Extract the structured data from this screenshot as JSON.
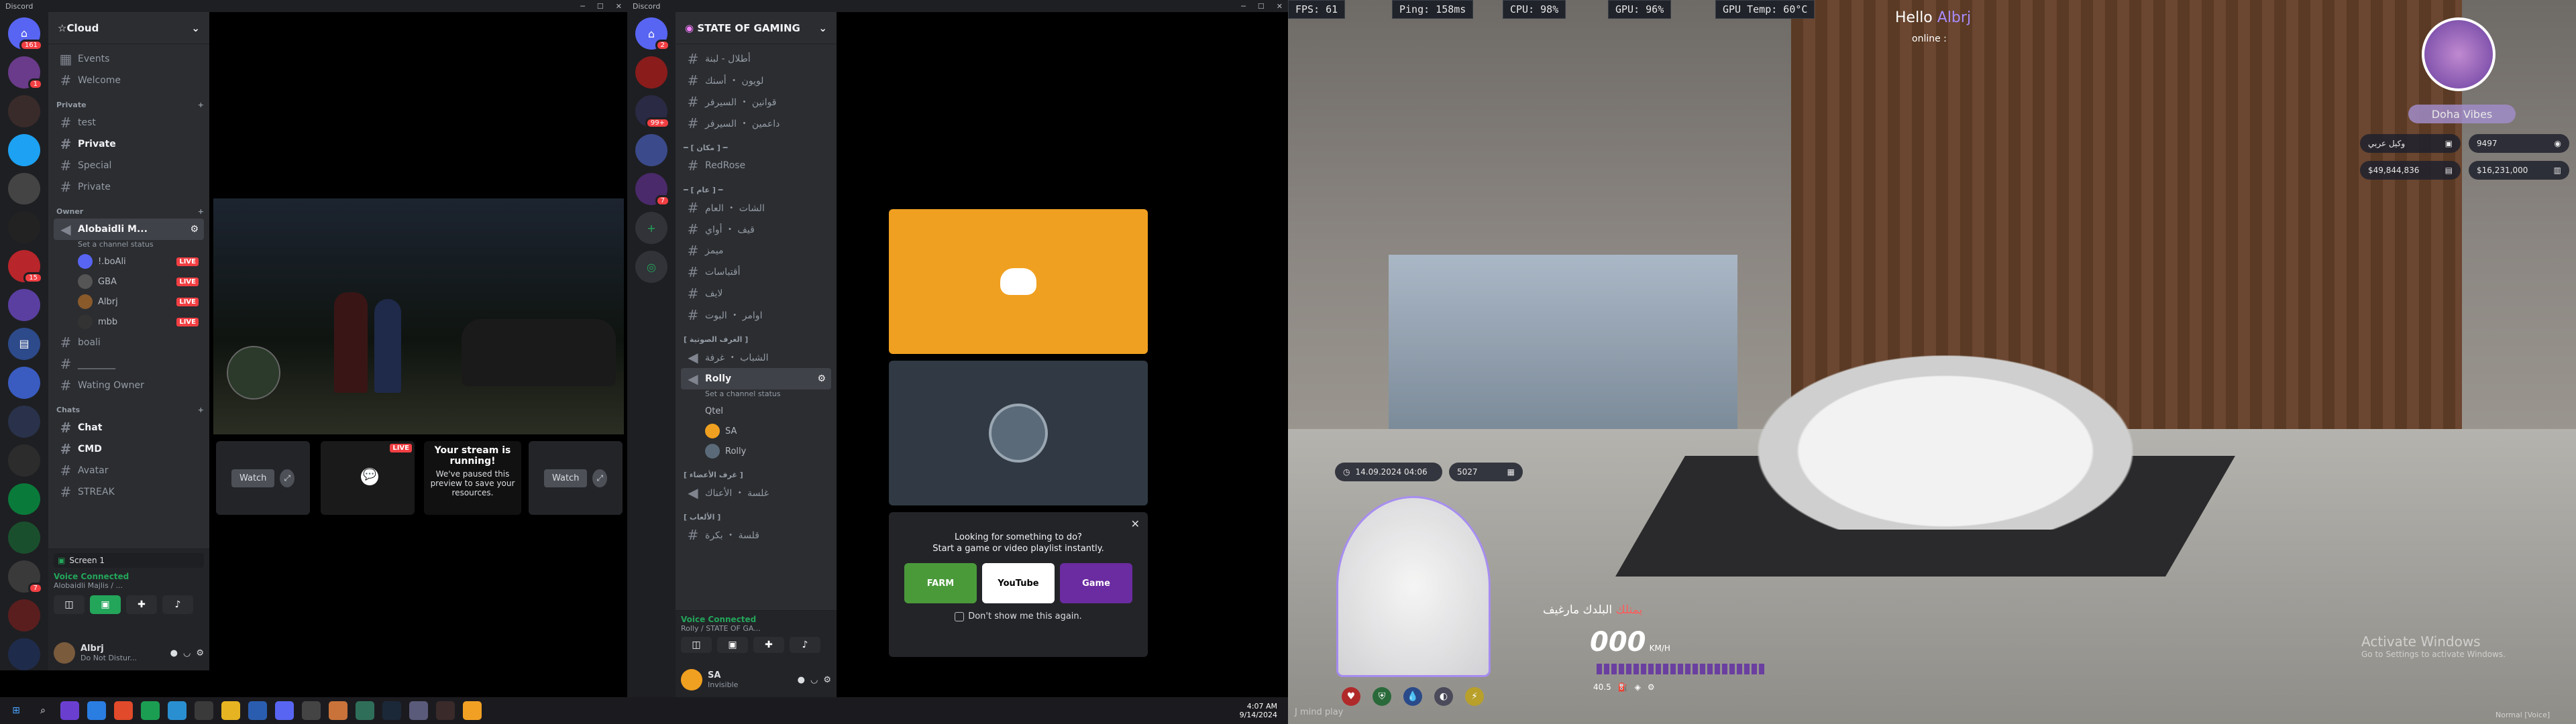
{
  "left_window": {
    "title": "Discord",
    "server_name": "☆Cloud",
    "events_label": "Events",
    "guild_badges": [
      "161",
      "1",
      "",
      "",
      "",
      "",
      "",
      "15",
      "",
      "",
      "",
      "",
      "",
      "",
      "",
      "",
      "7",
      "",
      "",
      ""
    ],
    "channels": [
      {
        "type": "text",
        "name": "Welcome"
      },
      {
        "type": "category",
        "name": "Private"
      },
      {
        "type": "text",
        "name": "test"
      },
      {
        "type": "text",
        "name": "Private",
        "bold": true
      },
      {
        "type": "text",
        "name": "Special"
      },
      {
        "type": "text",
        "name": "Private"
      },
      {
        "type": "category",
        "name": "Owner"
      }
    ],
    "voice_channel": {
      "name": "Alobaidli M...",
      "status": "Set a channel status"
    },
    "voice_users": [
      {
        "name": "!.boAli",
        "live": "LIVE"
      },
      {
        "name": "GBA",
        "live": "LIVE"
      },
      {
        "name": "Albrj",
        "live": "LIVE"
      },
      {
        "name": "mbb",
        "live": "LIVE"
      }
    ],
    "channels2": [
      {
        "type": "text",
        "name": "boali"
      },
      {
        "type": "text",
        "name": "________"
      },
      {
        "type": "text",
        "name": "Wating Owner"
      },
      {
        "type": "category",
        "name": "Chats"
      },
      {
        "type": "text",
        "name": "Chat",
        "bold": true
      },
      {
        "type": "text",
        "name": "CMD",
        "bold": true
      },
      {
        "type": "text",
        "name": "Avatar"
      },
      {
        "type": "text",
        "name": "STREAK"
      }
    ],
    "screen_label": "Screen 1",
    "voice_connected": "Voice Connected",
    "voice_sub": "Alobaidli Majlis / ...",
    "user": {
      "name": "Albrj",
      "status": "Do Not Distur..."
    },
    "stream_cards": {
      "watch": "Watch",
      "live": "LIVE",
      "paused_title": "Your stream is running!",
      "paused_body": "We've paused this preview to save your resources."
    }
  },
  "right_window": {
    "title": "Discord",
    "server_name": "STATE OF GAMING",
    "guild_badges": [
      "2",
      "",
      "99+",
      "",
      "7",
      "",
      ""
    ],
    "channels": [
      {
        "name": "أطلال - لبنة",
        "icon": "#"
      },
      {
        "name": "لويون ・ أسنك",
        "icon": "#"
      },
      {
        "name": "قوانين ・ السيرفر",
        "icon": "#"
      },
      {
        "name": "داعمين ・ السيرفر",
        "icon": "#"
      },
      {
        "name": "━ [ مكان ] ━",
        "icon": "cat"
      },
      {
        "name": "RedRose",
        "icon": "#"
      },
      {
        "name": "━ [ عام ] ━",
        "icon": "cat"
      },
      {
        "name": "الشات ・ العام",
        "icon": "#"
      },
      {
        "name": "قيف ・ أواي",
        "icon": "#"
      },
      {
        "name": "ميمز",
        "icon": "#"
      },
      {
        "name": "أقتباسات",
        "icon": "#"
      },
      {
        "name": "لايف",
        "icon": "#"
      },
      {
        "name": "اوامر ・ البوت",
        "icon": "#"
      },
      {
        "name": "[ الغرف الصوتية ]",
        "icon": "cat"
      },
      {
        "name": "الشباب ・ غرفة",
        "icon": "vc"
      }
    ],
    "voice_channel": {
      "name": "Rolly",
      "status": "Set a channel status"
    },
    "voice_users": [
      "Qtel",
      "SA",
      "Rolly"
    ],
    "channels2": [
      {
        "name": "[ غرف الأعضاء ]",
        "icon": "cat"
      },
      {
        "name": "غلسة ・ الأعناك",
        "icon": "vc"
      },
      {
        "name": "[ الألعاب ]",
        "icon": "cat"
      },
      {
        "name": "قلسة ・ بكرة",
        "icon": "#"
      }
    ],
    "voice_connected": "Voice Connected",
    "voice_sub": "Rolly / STATE OF GA...",
    "user": {
      "name": "SA",
      "status": "Invisible"
    },
    "activity": {
      "title": "Looking for something to do?",
      "subtitle": "Start a game or video playlist instantly.",
      "checkbox": "Don't show me this again.",
      "apps": [
        "FARM",
        "YouTube",
        "Game"
      ]
    }
  },
  "taskbar": {
    "time": "4:07 AM",
    "date": "9/14/2024"
  },
  "game": {
    "fps": "FPS: 61",
    "ping": "Ping: 158ms",
    "cpu": "CPU: 98%",
    "gpu": "GPU: 96%",
    "gpu_temp": "GPU Temp: 60°C",
    "hello": "Hello",
    "player": "Albrj",
    "online": "online :",
    "server_name": "Doha Vibes",
    "stats": [
      "وكيل عربي",
      "9497",
      "$49,844,836",
      "$16,231,000"
    ],
    "datetime": "14.09.2024 04:06",
    "id": "5027",
    "speed": "000",
    "speed_unit": "KM/H",
    "street": "البلدك مارغيف",
    "street_sub": "يمتلك",
    "fuel": "40.5",
    "watermark_title": "Activate Windows",
    "watermark_sub": "Go to Settings to activate Windows.",
    "corner_left": "J mind play",
    "corner_right": "Normal [Voice]"
  },
  "colors": {
    "discord_orange": "#f0a020",
    "discord_dark": "#2b2d31",
    "live_red": "#f23f43",
    "voice_green": "#23a55a",
    "accent_purple": "#a78bfa"
  }
}
